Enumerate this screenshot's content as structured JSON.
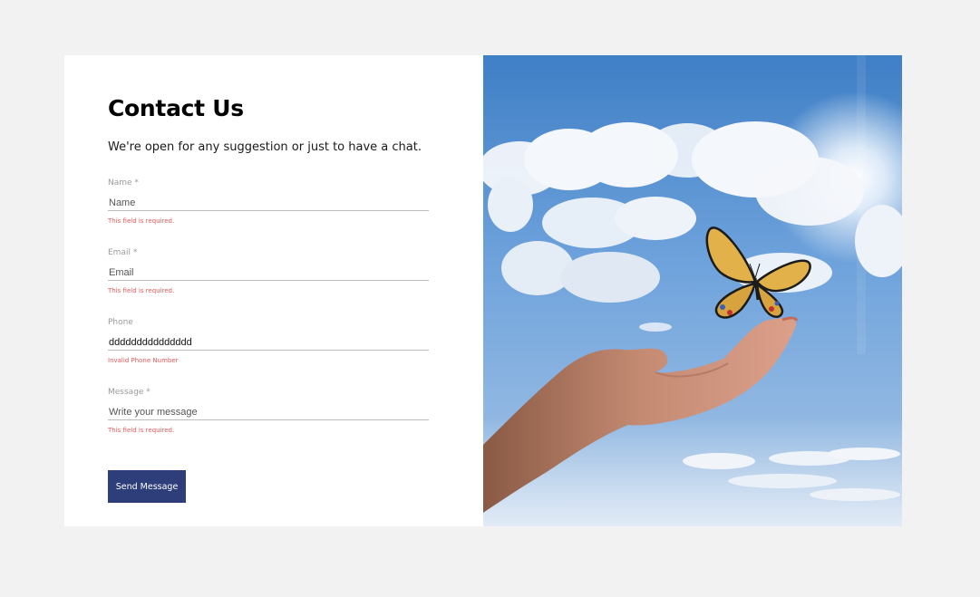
{
  "header": {
    "title": "Contact Us",
    "subtitle": "We're open for any suggestion or just to have a chat."
  },
  "form": {
    "fields": [
      {
        "label": "Name *",
        "value": "",
        "placeholder": "Name",
        "error": "This field is required."
      },
      {
        "label": "Email *",
        "value": "",
        "placeholder": "Email",
        "error": "This field is required."
      },
      {
        "label": "Phone",
        "value": "ddddddddddddddd",
        "placeholder": "",
        "error": "Invalid Phone Number"
      },
      {
        "label": "Message *",
        "value": "",
        "placeholder": "Write your message",
        "error": "This field is required."
      }
    ],
    "submit_label": "Send Message"
  },
  "colors": {
    "page_background": "#f2f2f2",
    "button": "#2e3e7a",
    "error": "#e05a5a",
    "sky": "#4a86cc"
  },
  "image": {
    "icon": "butterfly-on-hand-photo"
  }
}
